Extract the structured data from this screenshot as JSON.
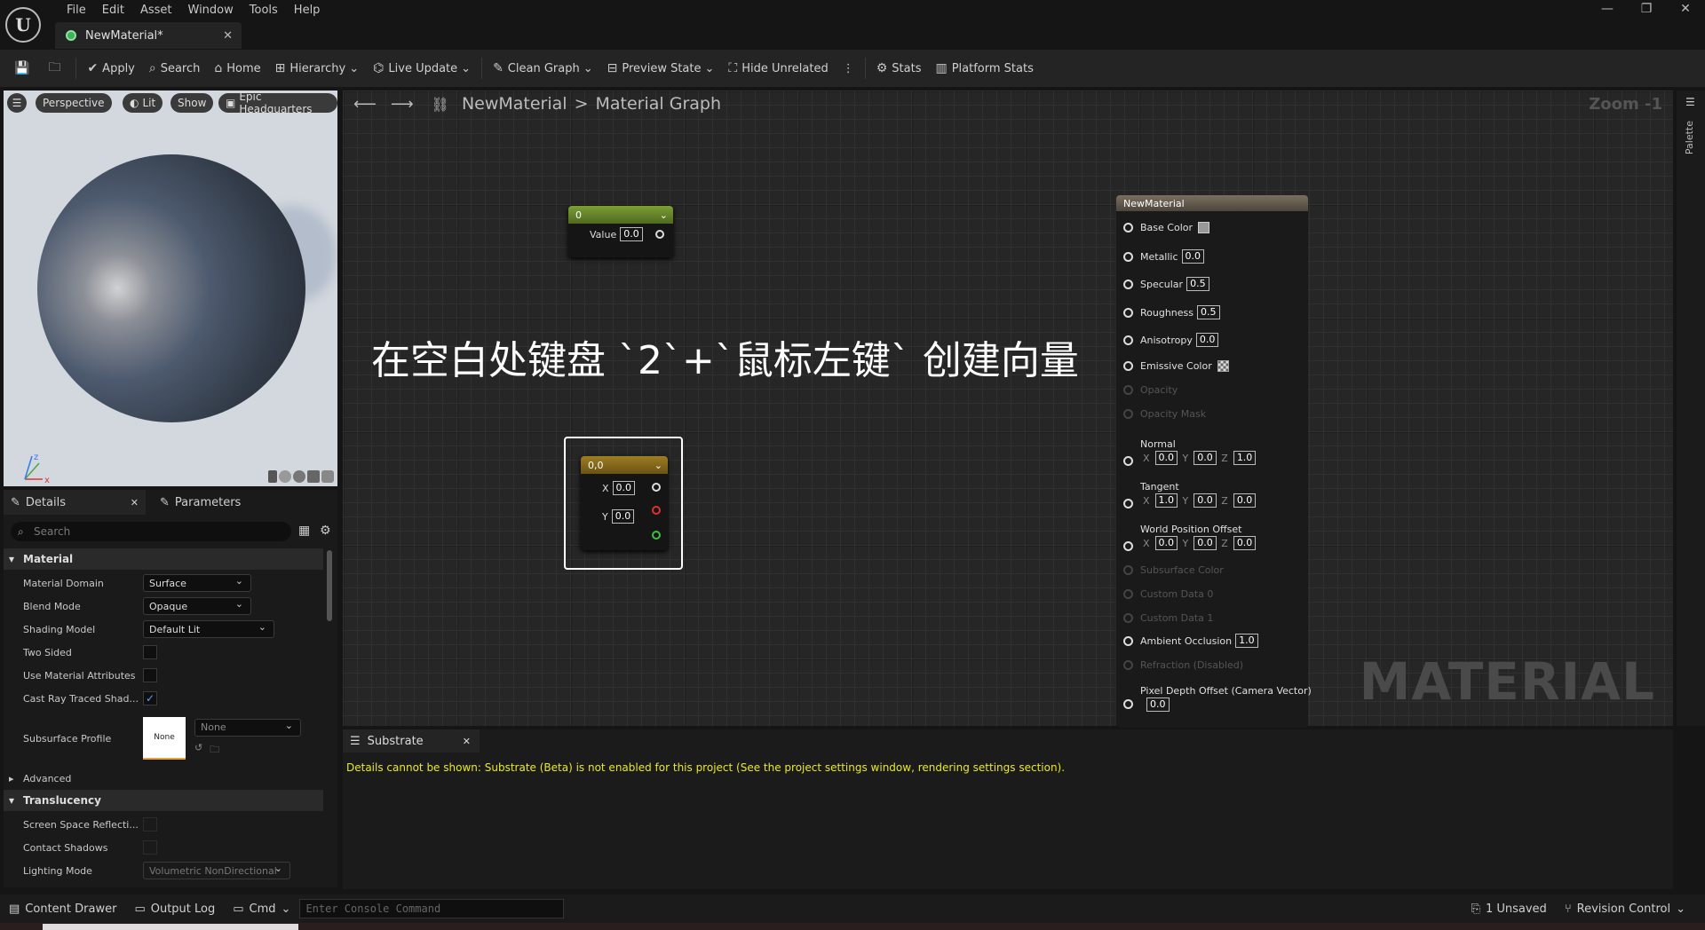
{
  "menu": [
    "File",
    "Edit",
    "Asset",
    "Window",
    "Tools",
    "Help"
  ],
  "doc_tab": "NewMaterial*",
  "window_controls": [
    "—",
    "❐",
    "✕"
  ],
  "toolbar": {
    "apply": "Apply",
    "search": "Search",
    "home": "Home",
    "hierarchy": "Hierarchy",
    "live_update": "Live Update",
    "clean_graph": "Clean Graph",
    "preview_state": "Preview State",
    "hide_unrelated": "Hide Unrelated",
    "stats": "Stats",
    "platform_stats": "Platform Stats"
  },
  "viewport": {
    "perspective": "Perspective",
    "lit": "Lit",
    "show": "Show",
    "hq": "Epic Headquarters"
  },
  "panel_tabs": {
    "details": "Details",
    "parameters": "Parameters"
  },
  "details": {
    "search_placeholder": "Search",
    "material_section": "Material",
    "rows": [
      {
        "label": "Material Domain",
        "value": "Surface"
      },
      {
        "label": "Blend Mode",
        "value": "Opaque"
      },
      {
        "label": "Shading Model",
        "value": "Default Lit"
      },
      {
        "label": "Two Sided",
        "value": ""
      },
      {
        "label": "Use Material Attributes",
        "value": ""
      },
      {
        "label": "Cast Ray Traced Shad...",
        "value": "✓"
      },
      {
        "label": "Subsurface Profile",
        "value": "None",
        "thumb": "None"
      }
    ],
    "advanced": "Advanced",
    "translucency_section": "Translucency",
    "trows": [
      {
        "label": "Screen Space Reflecti..."
      },
      {
        "label": "Contact Shadows"
      },
      {
        "label": "Lighting Mode",
        "value": "Volumetric NonDirectional"
      }
    ]
  },
  "graph": {
    "breadcrumb_root": "NewMaterial",
    "breadcrumb_sep": ">",
    "breadcrumb_leaf": "Material Graph",
    "zoom": "Zoom -1",
    "watermark": "MATERIAL",
    "overlay": "在空白处键盘 `2`+`鼠标左键` 创建向量"
  },
  "const_node": {
    "title": "0",
    "value_label": "Value",
    "value": "0.0"
  },
  "vec_node": {
    "title": "0,0",
    "x_label": "X",
    "x": "0.0",
    "y_label": "Y",
    "y": "0.0"
  },
  "material_node": {
    "title": "NewMaterial",
    "inputs": [
      {
        "label": "Base Color",
        "kind": "swatch"
      },
      {
        "label": "Metallic",
        "value": "0.0"
      },
      {
        "label": "Specular",
        "value": "0.5"
      },
      {
        "label": "Roughness",
        "value": "0.5"
      },
      {
        "label": "Anisotropy",
        "value": "0.0"
      },
      {
        "label": "Emissive Color",
        "kind": "checker"
      },
      {
        "label": "Opacity",
        "disabled": true
      },
      {
        "label": "Opacity Mask",
        "disabled": true
      },
      {
        "label": "Normal",
        "xyz": [
          "0.0",
          "0.0",
          "1.0"
        ]
      },
      {
        "label": "Tangent",
        "xyz": [
          "1.0",
          "0.0",
          "0.0"
        ]
      },
      {
        "label": "World Position Offset",
        "xyz": [
          "0.0",
          "0.0",
          "0.0"
        ]
      },
      {
        "label": "Subsurface Color",
        "disabled": true
      },
      {
        "label": "Custom Data 0",
        "disabled": true
      },
      {
        "label": "Custom Data 1",
        "disabled": true
      },
      {
        "label": "Ambient Occlusion",
        "value": "1.0"
      },
      {
        "label": "Refraction (Disabled)",
        "disabled": true
      },
      {
        "label": "Pixel Depth Offset (Camera Vector)",
        "value": "0.0"
      }
    ]
  },
  "palette": "Palette",
  "substrate": {
    "tab": "Substrate",
    "message": "Details cannot be shown: Substrate (Beta) is not enabled for this project (See the project settings window, rendering settings section)."
  },
  "status": {
    "content_drawer": "Content Drawer",
    "output_log": "Output Log",
    "cmd": "Cmd",
    "console_placeholder": "Enter Console Command",
    "unsaved": "1 Unsaved",
    "revision": "Revision Control"
  },
  "colors": {
    "accent_green": "#3fb25a",
    "node_green": "#6d8a2e",
    "node_gold": "#8a6c1c",
    "warning_yellow": "#e8e82a"
  }
}
